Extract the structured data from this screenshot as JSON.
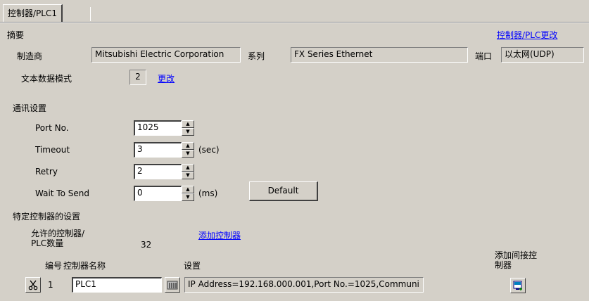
{
  "tab": {
    "label": "控制器/PLC1"
  },
  "summary": {
    "heading": "摘要",
    "change_link": "控制器/PLC更改",
    "manufacturer_label": "制造商",
    "manufacturer_value": "Mitsubishi Electric Corporation",
    "series_label": "系列",
    "series_value": "FX Series Ethernet",
    "port_label": "端口",
    "port_value": "以太网(UDP)",
    "text_mode_label": "文本数据模式",
    "text_mode_value": "2",
    "text_mode_change": "更改"
  },
  "comm": {
    "heading": "通讯设置",
    "port_label": "Port No.",
    "port_value": "1025",
    "timeout_label": "Timeout",
    "timeout_value": "3",
    "timeout_unit": "(sec)",
    "retry_label": "Retry",
    "retry_value": "2",
    "wait_label": "Wait To Send",
    "wait_value": "0",
    "wait_unit": "(ms)",
    "default_button": "Default"
  },
  "device": {
    "heading": "特定控制器的设置",
    "allowed_label_line1": "允许的控制器/",
    "allowed_label_line2": "PLC数量",
    "allowed_value": "32",
    "add_link": "添加控制器",
    "col_no": "编号",
    "col_name": "控制器名称",
    "col_settings": "设置",
    "add_indirect_line1": "添加间接控",
    "add_indirect_line2": "制器",
    "rows": [
      {
        "no": "1",
        "name": "PLC1",
        "settings": "IP Address=192.168.000.001,Port No.=1025,Communi"
      }
    ]
  }
}
